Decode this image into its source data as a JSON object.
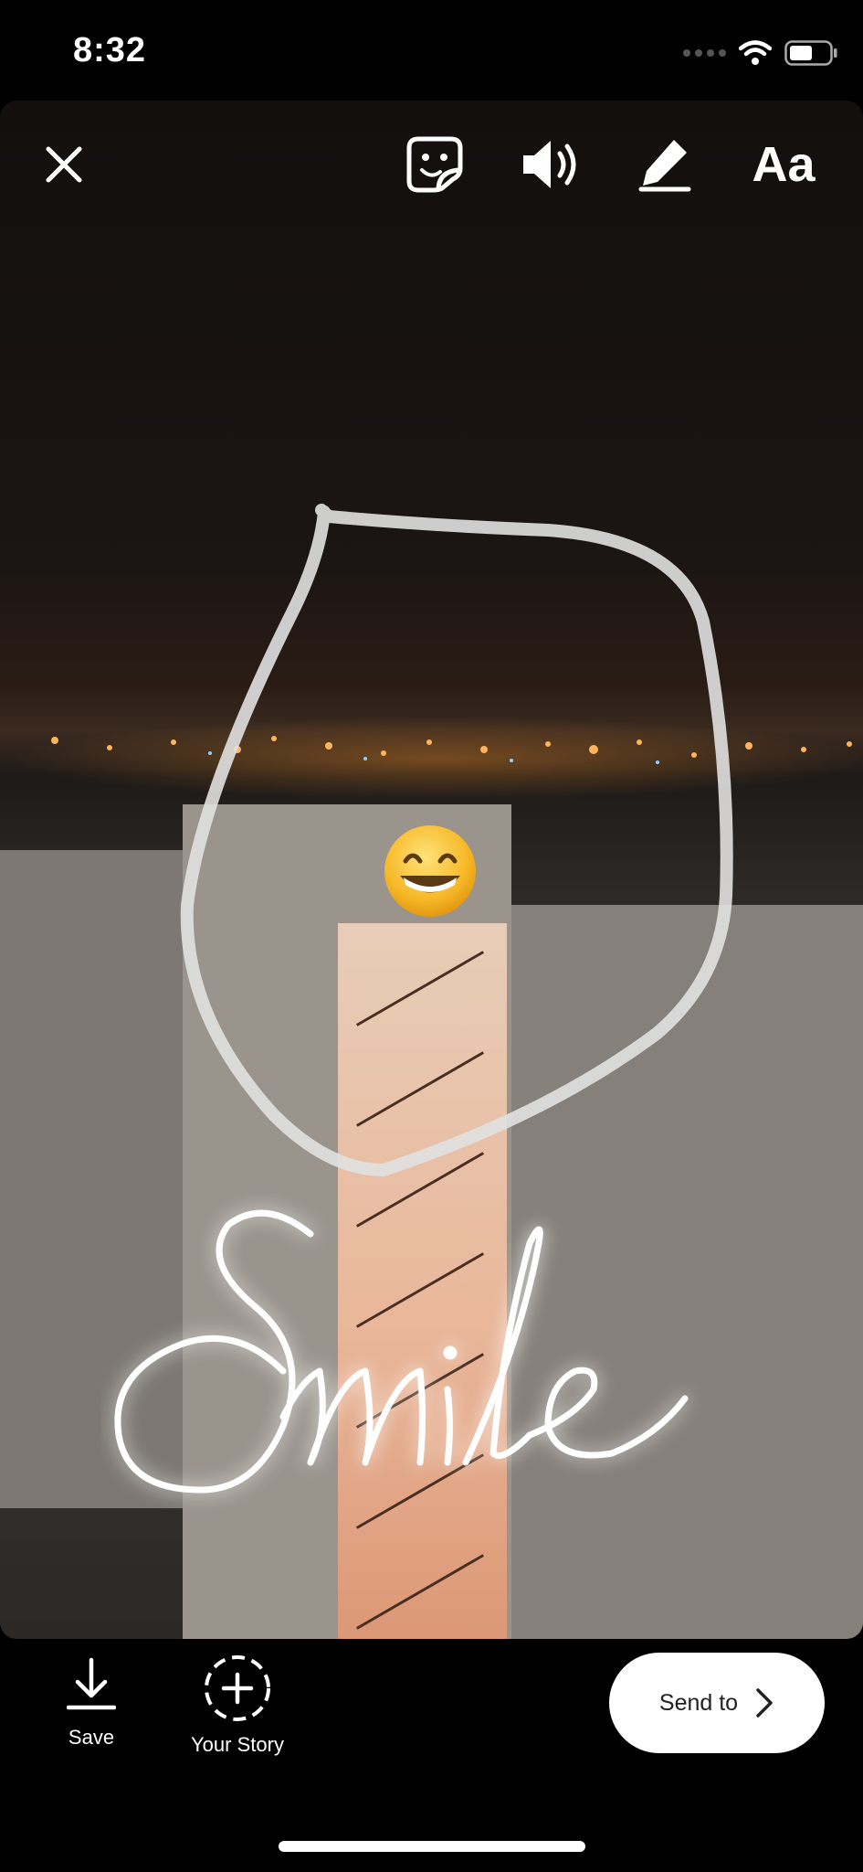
{
  "status_bar": {
    "time": "8:32"
  },
  "story": {
    "icons": {
      "close": "close-icon",
      "sticker": "sticker-icon",
      "sound": "speaker-icon",
      "draw": "pen-icon",
      "text_tool_label": "Aa"
    },
    "sticker_emoji": "grinning-face-emoji",
    "text_sticker": "Smile"
  },
  "bottom_bar": {
    "save_label": "Save",
    "your_story_label": "Your Story",
    "send_to_label": "Send to"
  },
  "colors": {
    "background": "#000000",
    "accent_button": "#ffffff"
  }
}
